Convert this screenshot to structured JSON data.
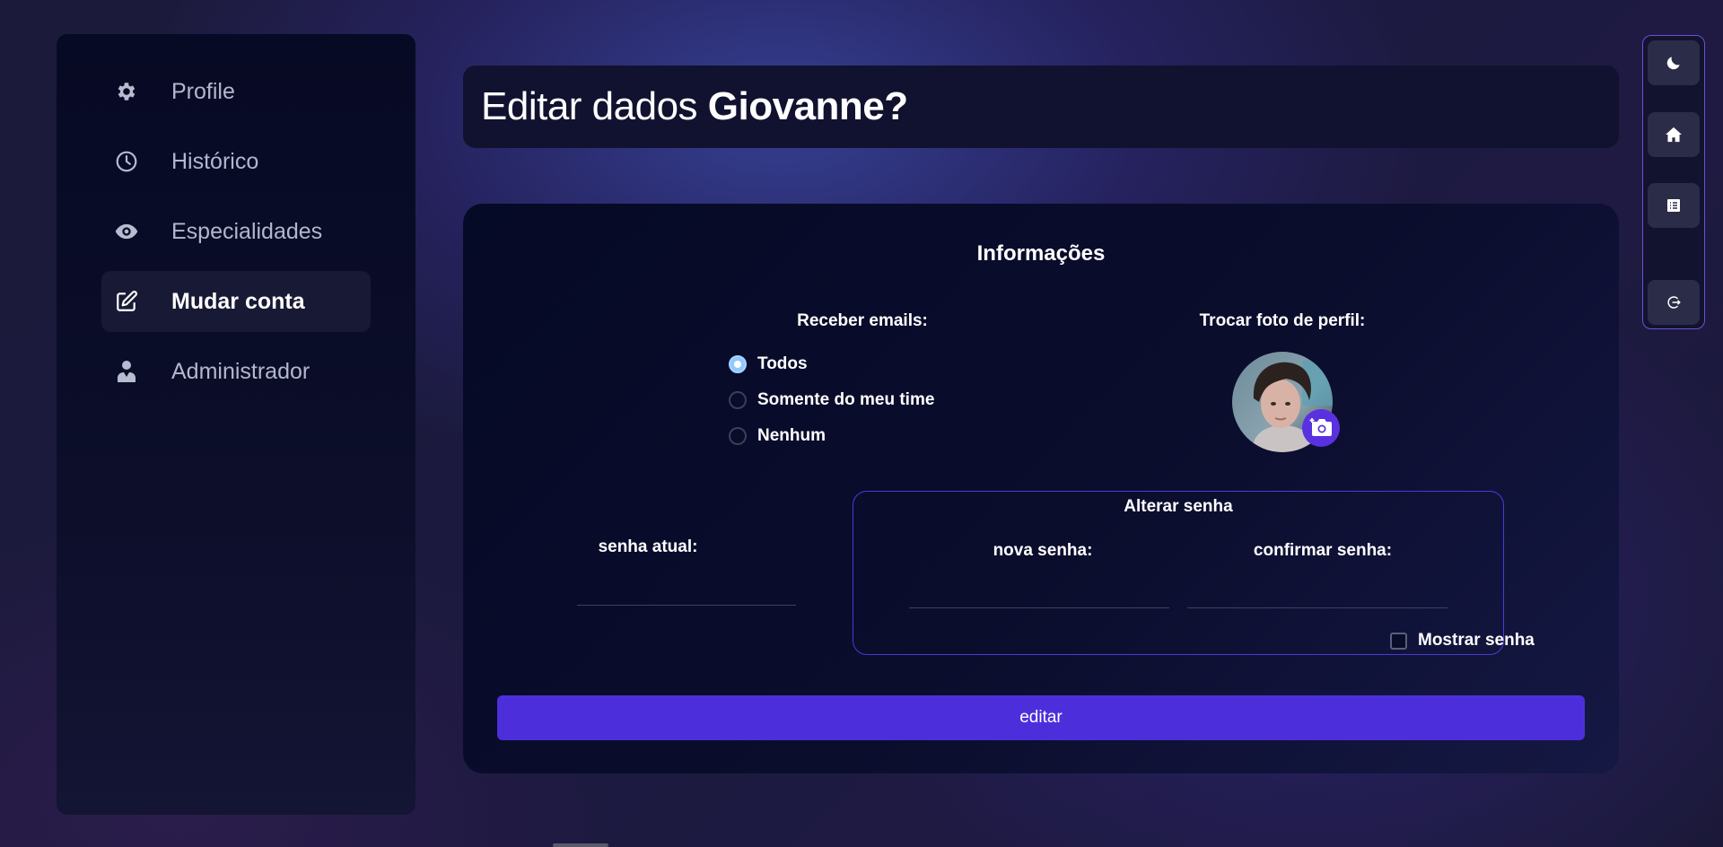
{
  "sidebar": {
    "items": [
      {
        "label": "Profile",
        "icon": "gear-icon"
      },
      {
        "label": "Histórico",
        "icon": "clock-icon"
      },
      {
        "label": "Especialidades",
        "icon": "eye-icon"
      },
      {
        "label": "Mudar conta",
        "icon": "edit-icon",
        "active": true
      },
      {
        "label": "Administrador",
        "icon": "user-tie-icon"
      }
    ]
  },
  "header": {
    "title_prefix": "Editar dados ",
    "title_name": "Giovanne?"
  },
  "card": {
    "title": "Informações",
    "emails": {
      "label": "Receber emails:",
      "options": [
        "Todos",
        "Somente do meu time",
        "Nenhum"
      ],
      "selected": "Todos"
    },
    "photo": {
      "label": "Trocar foto de perfil:"
    },
    "current_password": {
      "label": "senha atual:",
      "value": ""
    },
    "change_password": {
      "title": "Alterar senha",
      "new_label": "nova senha:",
      "confirm_label": "confirmar senha:",
      "new_value": "",
      "confirm_value": "",
      "show_password_label": "Mostrar senha"
    },
    "submit_label": "editar"
  },
  "rail": {
    "buttons": [
      "moon-icon",
      "home-icon",
      "list-icon",
      "logout-icon"
    ]
  },
  "colors": {
    "accent": "#4c2fdb",
    "panel": "#070a24",
    "radio_checked": "#8fcaff"
  }
}
